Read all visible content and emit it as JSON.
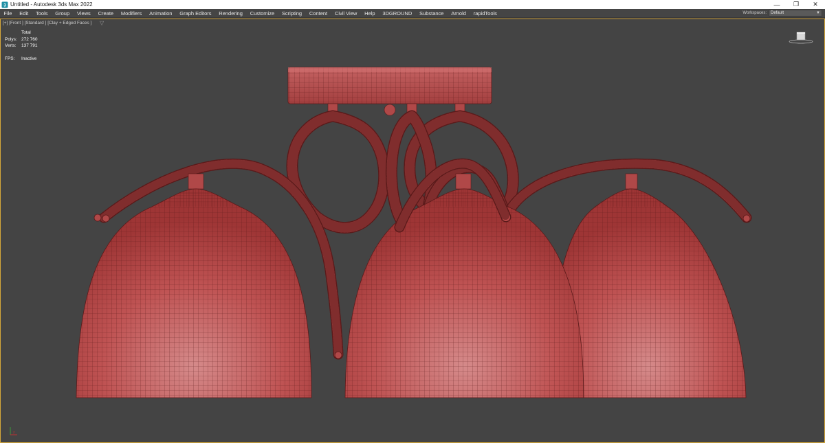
{
  "titlebar": {
    "title": "Untitled - Autodesk 3ds Max 2022",
    "minimize": "—",
    "restore": "❐",
    "close": "✕"
  },
  "menu": {
    "items": [
      "File",
      "Edit",
      "Tools",
      "Group",
      "Views",
      "Create",
      "Modifiers",
      "Animation",
      "Graph Editors",
      "Rendering",
      "Customize",
      "Scripting",
      "Content",
      "Civil View",
      "Help",
      "3DGROUND",
      "Substance",
      "Arnold",
      "rapidTools"
    ]
  },
  "workspace": {
    "label": "Workspaces:",
    "value": "Default"
  },
  "viewport": {
    "label": "[+] [Front ] [Standard ] [Clay + Edged Faces ]",
    "stats": {
      "header": "Total",
      "polys_label": "Polys:",
      "polys_value": "272 760",
      "verts_label": "Verts:",
      "verts_value": "137 791",
      "fps_label": "FPS:",
      "fps_value": "Inactive"
    }
  },
  "colors": {
    "viewport_bg": "#444444",
    "model_fill": "#b84848",
    "wire": "#5a1a1a",
    "viewport_border": "#d7a93a"
  },
  "icons": {
    "app": "3ds-max-logo-icon",
    "filter": "filter-icon",
    "viewcube": "viewcube-icon",
    "axis": "axis-tripod-icon"
  }
}
